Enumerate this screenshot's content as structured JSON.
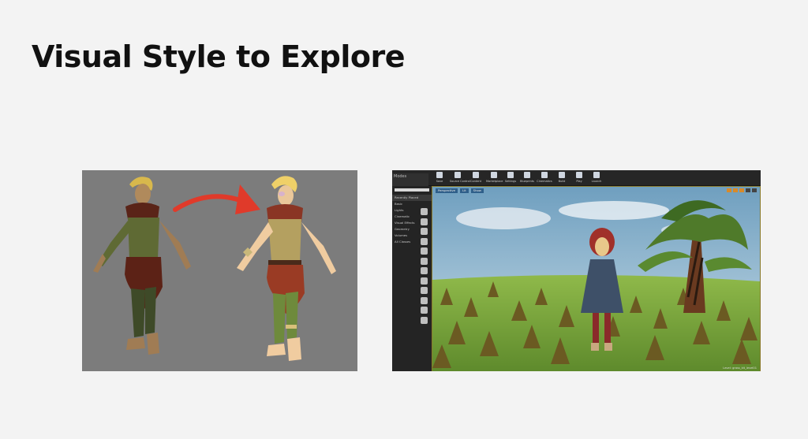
{
  "slide": {
    "title": "Visual Style to Explore"
  },
  "colors": {
    "background": "#f3f3f3",
    "title": "#111111",
    "left_panel_bg": "#7c7c7c",
    "arrow": "#e03a2a"
  },
  "ue_editor": {
    "toolbar_tab": "Modes",
    "toolbar": [
      {
        "label": "Save",
        "icon": "save-icon"
      },
      {
        "label": "Source Control",
        "icon": "source-control-icon"
      },
      {
        "label": "Content",
        "icon": "content-icon"
      },
      {
        "label": "Marketplace",
        "icon": "marketplace-icon"
      },
      {
        "label": "Settings",
        "icon": "settings-icon"
      },
      {
        "label": "Blueprints",
        "icon": "blueprints-icon"
      },
      {
        "label": "Cinematics",
        "icon": "cinematics-icon"
      },
      {
        "label": "Build",
        "icon": "build-icon"
      },
      {
        "label": "Play",
        "icon": "play-icon"
      },
      {
        "label": "Launch",
        "icon": "launch-icon"
      }
    ],
    "placement_categories": [
      "Recently Placed",
      "Basic",
      "Lights",
      "Cinematic",
      "Visual Effects",
      "Geometry",
      "Volumes",
      "All Classes"
    ],
    "viewport": {
      "perspective_label": "Perspective",
      "lit_label": "Lit",
      "show_label": "Show",
      "level_label": "Level: grass_kit_level01"
    }
  }
}
